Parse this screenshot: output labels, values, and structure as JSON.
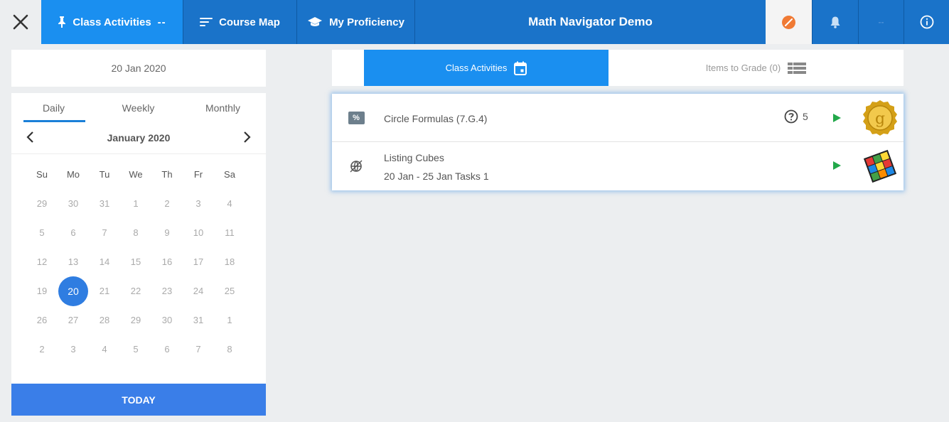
{
  "topbar": {
    "tab_class_activities": "Class Activities",
    "tab_class_activities_suffix": "--",
    "tab_course_map": "Course Map",
    "tab_my_proficiency": "My Proficiency",
    "title": "Math Navigator Demo",
    "placeholder_text": "--"
  },
  "calendar": {
    "selected_date": "20 Jan 2020",
    "views": [
      "Daily",
      "Weekly",
      "Monthly"
    ],
    "active_view": "Daily",
    "month_label": "January 2020",
    "weekdays": [
      "Su",
      "Mo",
      "Tu",
      "We",
      "Th",
      "Fr",
      "Sa"
    ],
    "weeks": [
      [
        "29",
        "30",
        "31",
        "1",
        "2",
        "3",
        "4"
      ],
      [
        "5",
        "6",
        "7",
        "8",
        "9",
        "10",
        "11"
      ],
      [
        "12",
        "13",
        "14",
        "15",
        "16",
        "17",
        "18"
      ],
      [
        "19",
        "20",
        "21",
        "22",
        "23",
        "24",
        "25"
      ],
      [
        "26",
        "27",
        "28",
        "29",
        "30",
        "31",
        "1"
      ],
      [
        "2",
        "3",
        "4",
        "5",
        "6",
        "7",
        "8"
      ]
    ],
    "selected_day": "20",
    "today_label": "TODAY"
  },
  "content_tabs": {
    "class_activities": "Class Activities",
    "items_to_grade": "Items to Grade (0)"
  },
  "activities": [
    {
      "title": "Circle Formulas (7.G.4)",
      "icon": "percent-icon",
      "question_count": "5",
      "badge_letter": "g"
    },
    {
      "title": "Listing Cubes",
      "subtitle": "20 Jan - 25 Jan Tasks 1",
      "icon": "no-standard-icon"
    }
  ],
  "colors": {
    "primary": "#1a73c9",
    "active_tab": "#1a8ff0",
    "today_button": "#3a7ee8",
    "selected_day": "#2f7de1",
    "play": "#22a84a",
    "compass": "#f07a34"
  }
}
